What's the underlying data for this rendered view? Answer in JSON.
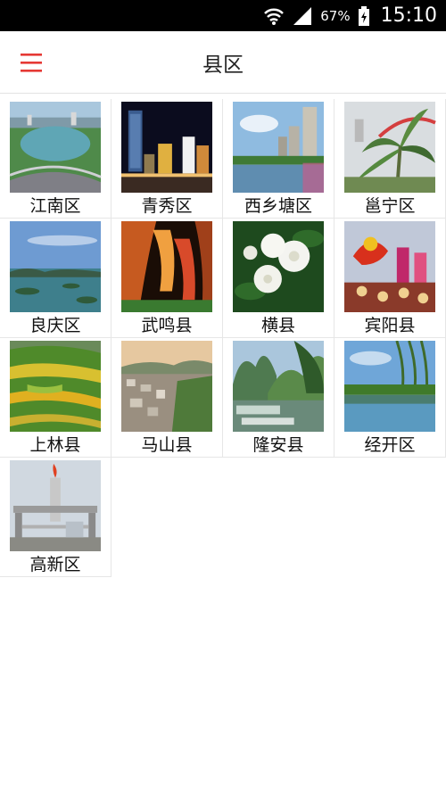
{
  "status_bar": {
    "battery": "67%",
    "time": "15:10",
    "icons": [
      "wifi-icon",
      "signal-icon",
      "battery-icon"
    ]
  },
  "toolbar": {
    "title": "县区",
    "menu_icon": "hamburger-menu-icon",
    "accent_color": "#e53935"
  },
  "districts": [
    {
      "name": "江南区",
      "image": "lake-park-aerial"
    },
    {
      "name": "青秀区",
      "image": "city-night-skyline"
    },
    {
      "name": "西乡塘区",
      "image": "lakeside-towers"
    },
    {
      "name": "邕宁区",
      "image": "bridge-banana-tree"
    },
    {
      "name": "良庆区",
      "image": "lake-islands"
    },
    {
      "name": "武鸣县",
      "image": "lit-cave"
    },
    {
      "name": "横县",
      "image": "jasmine-flowers"
    },
    {
      "name": "宾阳县",
      "image": "dragon-festival"
    },
    {
      "name": "上林县",
      "image": "terraced-fields"
    },
    {
      "name": "马山县",
      "image": "town-valley"
    },
    {
      "name": "隆安县",
      "image": "karst-river"
    },
    {
      "name": "经开区",
      "image": "willow-pond"
    },
    {
      "name": "高新区",
      "image": "industrial-park-gate"
    }
  ]
}
